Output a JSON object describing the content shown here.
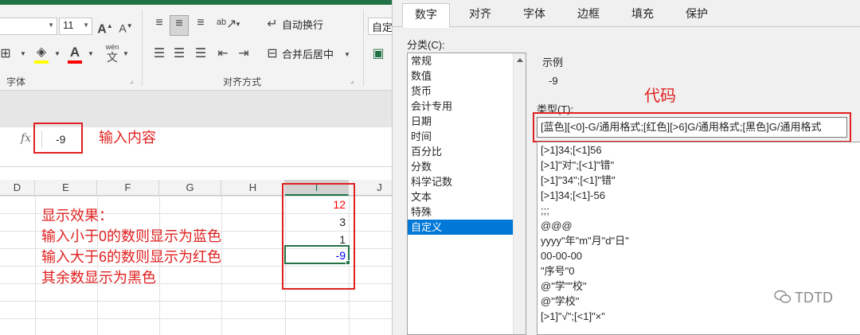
{
  "excel": {
    "ribbon": {
      "font_size": "11",
      "grow_font": "A",
      "shrink_font": "A",
      "phonetic": "wén",
      "phonetic_char": "文",
      "wrap_text_label": "自动换行",
      "merge_center_label": "合并后居中",
      "number_format_partial": "自定",
      "font_group_label": "字体",
      "align_group_label": "对齐方式"
    },
    "formula_bar": {
      "fx": "fx",
      "value": "-9"
    },
    "annotations": {
      "input_content": "输入内容",
      "effect": [
        "显示效果：",
        "输入小于0的数则显示为蓝色",
        "输入大于6的数则显示为红色",
        "其余数显示为黑色"
      ]
    },
    "columns": [
      "D",
      "E",
      "F",
      "G",
      "H",
      "I",
      "J"
    ],
    "cells": [
      {
        "value": "12",
        "color": "#ff0000"
      },
      {
        "value": "3",
        "color": "#262626"
      },
      {
        "value": "1",
        "color": "#262626"
      },
      {
        "value": "-9",
        "color": "#0000ff"
      }
    ]
  },
  "dialog": {
    "tabs": [
      "数字",
      "对齐",
      "字体",
      "边框",
      "填充",
      "保护"
    ],
    "active_tab": "数字",
    "category_label": "分类(C):",
    "categories": [
      "常规",
      "数值",
      "货币",
      "会计专用",
      "日期",
      "时间",
      "百分比",
      "分数",
      "科学记数",
      "文本",
      "特殊",
      "自定义"
    ],
    "selected_category": "自定义",
    "sample_label": "示例",
    "sample_value": "-9",
    "code_annotation": "代码",
    "type_label": "类型(T):",
    "type_value": "[蓝色][<0]-G/通用格式;[红色][>6]G/通用格式;[黑色]G/通用格式",
    "format_list": [
      "[>1]34;[<1]56",
      "[>1]\"对\";[<1]\"错\"",
      "[>1]\"34\";[<1]\"错\"",
      "[>1]34;[<1]-56",
      ";;;",
      "@@@",
      "yyyy\"年\"m\"月\"d\"日\"",
      "00-00-00",
      "\"序号\"0",
      "@\"学\"\"校\"",
      "@\"学校\"",
      "[>1]\"√\";[<1]\"×\""
    ]
  },
  "watermark": "TDTD",
  "colors": {
    "excel_green": "#217346",
    "annotation_red": "#e02020",
    "selection_blue": "#0078d7"
  }
}
